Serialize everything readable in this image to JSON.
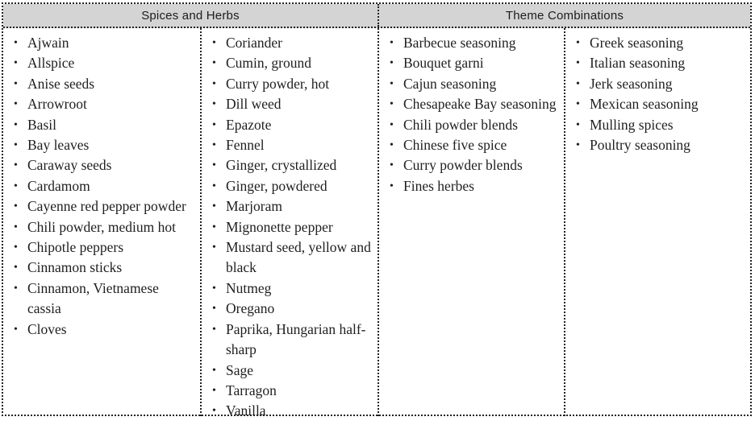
{
  "table": {
    "headers": [
      {
        "label": "Spices and Herbs"
      },
      {
        "label": "Theme Combinations"
      }
    ],
    "columns": [
      {
        "id": "spices-column-1",
        "items": [
          "Ajwain",
          "Allspice",
          "Anise seeds",
          "Arrowroot",
          "Basil",
          "Bay leaves",
          "Caraway seeds",
          "Cardamom",
          "Cayenne red pepper powder",
          "Chili powder, medium hot",
          "Chipotle peppers",
          "Cinnamon sticks",
          "Cinnamon, Vietnamese cassia",
          "Cloves"
        ]
      },
      {
        "id": "spices-column-2",
        "items": [
          "Coriander",
          "Cumin, ground",
          "Curry powder, hot",
          "Dill weed",
          "Epazote",
          "Fennel",
          "Ginger, crystallized",
          "Ginger, powdered",
          "Marjoram",
          "Mignonette pepper",
          "Mustard seed, yellow and black",
          "Nutmeg",
          "Oregano",
          "Paprika, Hungarian half-sharp",
          "Sage",
          "Tarragon",
          "Vanilla"
        ]
      },
      {
        "id": "themes-column-1",
        "items": [
          "Barbecue seasoning",
          "Bouquet garni",
          "Cajun seasoning",
          "Chesapeake Bay seasoning",
          "Chili powder blends",
          "Chinese five spice",
          "Curry powder blends",
          "Fines herbes"
        ]
      },
      {
        "id": "themes-column-2",
        "items": [
          "Greek seasoning",
          "Italian seasoning",
          "Jerk seasoning",
          "Mexican seasoning",
          "Mulling spices",
          "Poultry seasoning"
        ]
      }
    ]
  },
  "style": {
    "header_background": "#d4d4d4",
    "border_color": "#222222",
    "text_color": "#1f1f1f",
    "page_background": "#ffffff"
  }
}
